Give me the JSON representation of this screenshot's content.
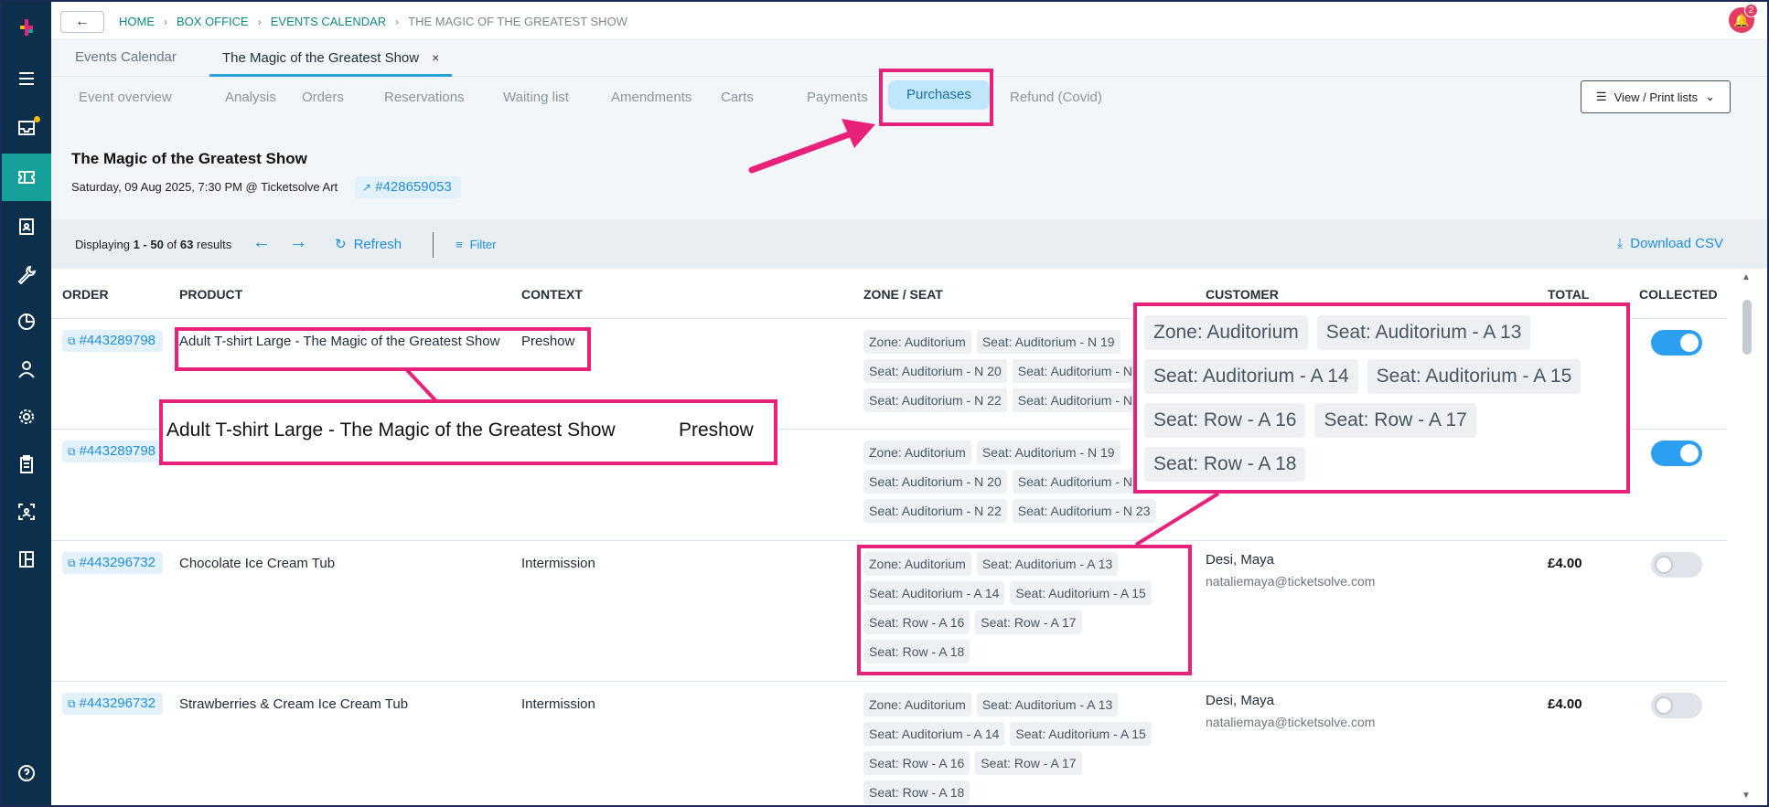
{
  "colors": {
    "sidebar_bg": "#0c2f4c",
    "sidebar_active": "#16a19a",
    "accent_blue": "#1e8fd8",
    "breadcrumb_green": "#0f8a7f",
    "annotation_pink": "#e8217a",
    "toggle_on": "#2c9ff0"
  },
  "sidebar": {
    "icons": [
      "logo-icon",
      "menu-icon",
      "inbox-icon",
      "ticket-icon",
      "contacts-icon",
      "wrench-icon",
      "chart-icon",
      "user-icon",
      "gear-icon",
      "clipboard-icon",
      "scan-icon",
      "layout-icon",
      "help-icon"
    ]
  },
  "topbar": {
    "back_label": "←",
    "breadcrumb": [
      "HOME",
      "BOX OFFICE",
      "EVENTS CALENDAR",
      "THE MAGIC OF THE GREATEST SHOW"
    ],
    "notification_count": "2"
  },
  "doctabs": {
    "tab1": "Events Calendar",
    "tab2": "The Magic of the Greatest Show",
    "close": "×"
  },
  "subnav": {
    "tabs": [
      "Event overview",
      "Analysis",
      "Orders",
      "Reservations",
      "Waiting list",
      "Amendments",
      "Carts",
      "Payments",
      "Purchases",
      "Refund (Covid)"
    ],
    "view_print": "View / Print lists"
  },
  "event": {
    "title": "The Magic of the Greatest Show",
    "subtitle": "Saturday, 09 Aug 2025, 7:30 PM @ Ticketsolve Art",
    "id": "#428659053"
  },
  "toolbar": {
    "displaying_prefix": "Displaying ",
    "range": "1 - 50",
    "of": " of ",
    "total": "63",
    "suffix": " results",
    "refresh": "Refresh",
    "filter": "Filter",
    "download": "Download CSV"
  },
  "table": {
    "headers": {
      "order": "ORDER",
      "product": "PRODUCT",
      "context": "CONTEXT",
      "zone_seat": "ZONE / SEAT",
      "customer": "CUSTOMER",
      "total": "TOTAL",
      "collected": "COLLECTED"
    },
    "rows": [
      {
        "order": "#443289798",
        "product": "Adult T-shirt Large - The Magic of the Greatest Show",
        "context": "Preshow",
        "seats": [
          "Zone: Auditorium",
          "Seat: Auditorium - N 19",
          "Seat: Auditorium - N 20",
          "Seat: Auditorium - N 21",
          "Seat: Auditorium - N 22",
          "Seat: Auditorium - N 23"
        ],
        "customer": "",
        "email": "",
        "total": "",
        "collected": true
      },
      {
        "order": "#443289798",
        "product": "",
        "context": "",
        "seats": [
          "Zone: Auditorium",
          "Seat: Auditorium - N 19",
          "Seat: Auditorium - N 20",
          "Seat: Auditorium - N 21",
          "Seat: Auditorium - N 22",
          "Seat: Auditorium - N 23"
        ],
        "customer": "",
        "email": "",
        "total": "",
        "collected": true
      },
      {
        "order": "#443296732",
        "product": "Chocolate Ice Cream Tub",
        "context": "Intermission",
        "seats": [
          "Zone: Auditorium",
          "Seat: Auditorium - A 13",
          "Seat: Auditorium - A 14",
          "Seat: Auditorium - A 15",
          "Seat: Row - A 16",
          "Seat: Row - A 17",
          "Seat: Row - A 18"
        ],
        "customer": "Desi, Maya",
        "email": "nataliemaya@ticketsolve.com",
        "total": "£4.00",
        "collected": false
      },
      {
        "order": "#443296732",
        "product": "Strawberries & Cream Ice Cream Tub",
        "context": "Intermission",
        "seats": [
          "Zone: Auditorium",
          "Seat: Auditorium - A 13",
          "Seat: Auditorium - A 14",
          "Seat: Auditorium - A 15",
          "Seat: Row - A 16",
          "Seat: Row - A 17",
          "Seat: Row - A 18"
        ],
        "customer": "Desi, Maya",
        "email": "nataliemaya@ticketsolve.com",
        "total": "£4.00",
        "collected": false
      }
    ]
  },
  "callouts": {
    "product_zoom": "Adult T-shirt Large - The Magic of the Greatest Show",
    "context_zoom": "Preshow",
    "seats_zoom": [
      "Zone: Auditorium",
      "Seat: Auditorium - A 13",
      "Seat: Auditorium - A 14",
      "Seat: Auditorium - A 15",
      "Seat: Row - A 16",
      "Seat: Row - A 17",
      "Seat: Row - A 18"
    ]
  }
}
